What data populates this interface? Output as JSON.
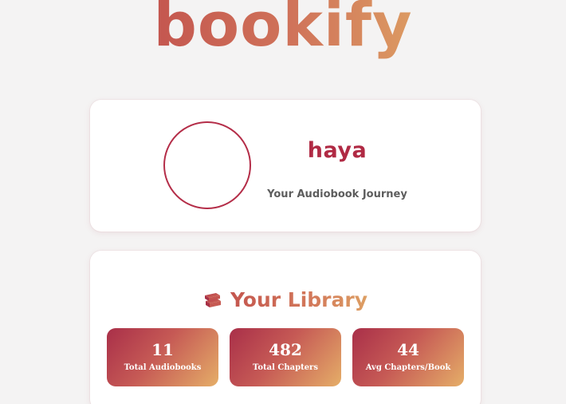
{
  "brand": {
    "logo_text": "bookify"
  },
  "profile": {
    "username": "haya",
    "tagline": "Your Audiobook Journey"
  },
  "library": {
    "icon": "books-icon",
    "title": "Your Library",
    "stats": [
      {
        "value": "11",
        "label": "Total Audiobooks"
      },
      {
        "value": "482",
        "label": "Total Chapters"
      },
      {
        "value": "44",
        "label": "Avg Chapters/Book"
      }
    ]
  },
  "colors": {
    "background": "#f4f3f3",
    "accent": "#b02a44",
    "gradient_start": "#a92f49",
    "gradient_end": "#e5ae68"
  }
}
